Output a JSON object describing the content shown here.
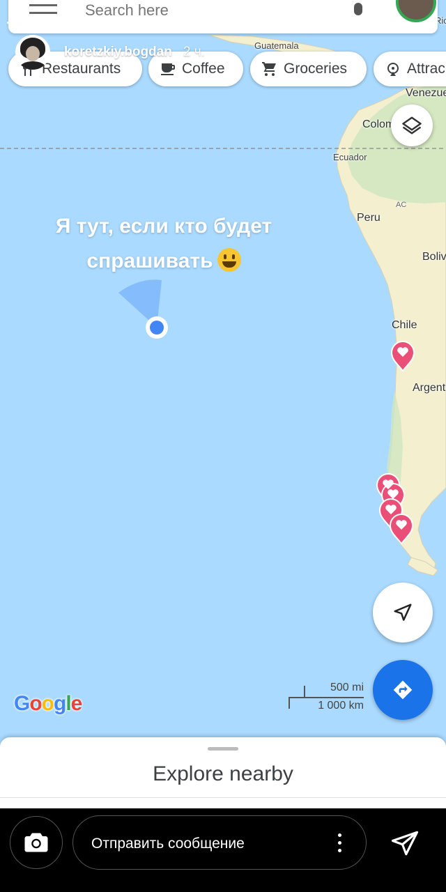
{
  "story": {
    "username": "koretzkiy.bogdan",
    "time_ago": "2 ч.",
    "progress_fraction": 1.0,
    "text_line1": "Я тут, если кто будет",
    "text_line2": "спрашивать",
    "emoji": "grinning-face"
  },
  "map_app": {
    "search_placeholder": "Search here",
    "chips": [
      {
        "label": "Restaurants",
        "icon": "fork-knife-icon"
      },
      {
        "label": "Coffee",
        "icon": "coffee-cup-icon"
      },
      {
        "label": "Groceries",
        "icon": "shopping-cart-icon"
      },
      {
        "label": "Attrac",
        "icon": "attractions-icon"
      }
    ],
    "map_labels": {
      "guatemala": "Guatemala",
      "rio": "Rio",
      "venezuela": "Venezue",
      "colombia": "Colom",
      "ecuador": "Ecuador",
      "peru": "Peru",
      "acre": "AC",
      "bolivia": "Boliv",
      "chile": "Chile",
      "argentina": "Argent"
    },
    "google_logo": "Google",
    "scale_mi": "500 mi",
    "scale_km": "1 000 km",
    "bottom_sheet_title": "Explore nearby",
    "colors": {
      "water": "#aadaff",
      "land": "#f3efcf",
      "accent_blue": "#1a73e8",
      "saved_pin": "#ea4f77",
      "location_dot": "#4285f4"
    }
  },
  "reply_bar": {
    "placeholder": "Отправить сообщение"
  }
}
